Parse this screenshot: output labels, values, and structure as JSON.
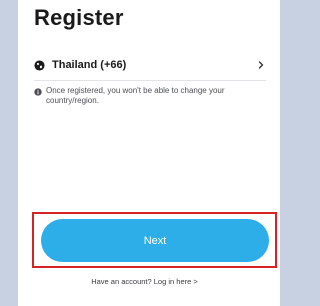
{
  "page": {
    "title": "Register"
  },
  "country": {
    "label": "Thailand (+66)",
    "icon": "globe-icon",
    "chevron_icon": "chevron-right-icon"
  },
  "notice": {
    "icon": "info-icon",
    "text": "Once registered, you won't be able to change your country/region."
  },
  "actions": {
    "next_label": "Next",
    "login_link": "Have an account? Log in here >"
  },
  "colors": {
    "primary_button": "#2eaee8",
    "highlight_border": "#d52222",
    "background": "#c7d1e1"
  }
}
